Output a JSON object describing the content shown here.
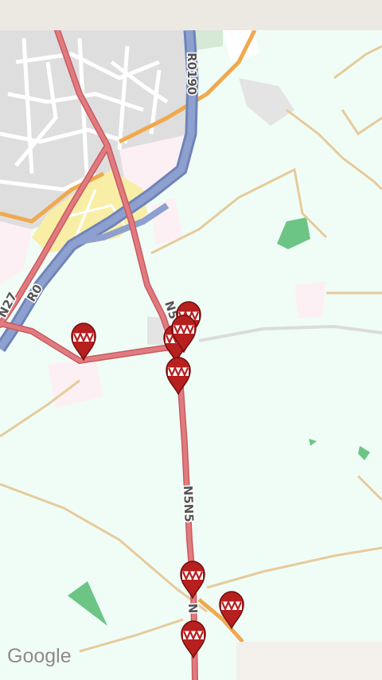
{
  "map": {
    "logo_text": "Google",
    "road_labels": {
      "r0190": "R0190",
      "r0": "R0",
      "n27": "N27",
      "n5_upper": "N5",
      "n5_middle": "N5N5",
      "n5_lower": "N"
    },
    "colors": {
      "background": "#f0fdf6",
      "urban": "#dedede",
      "main_road": "#d9656b",
      "motorway": "#7b8fc2",
      "secondary_road": "#f0a94e",
      "minor_road": "#e8c99a",
      "park": "#6cc585",
      "marker": "#b81f1f"
    },
    "marker_icon": "hot-air-balloon-pin-icon",
    "markers_count_visible": 9
  }
}
